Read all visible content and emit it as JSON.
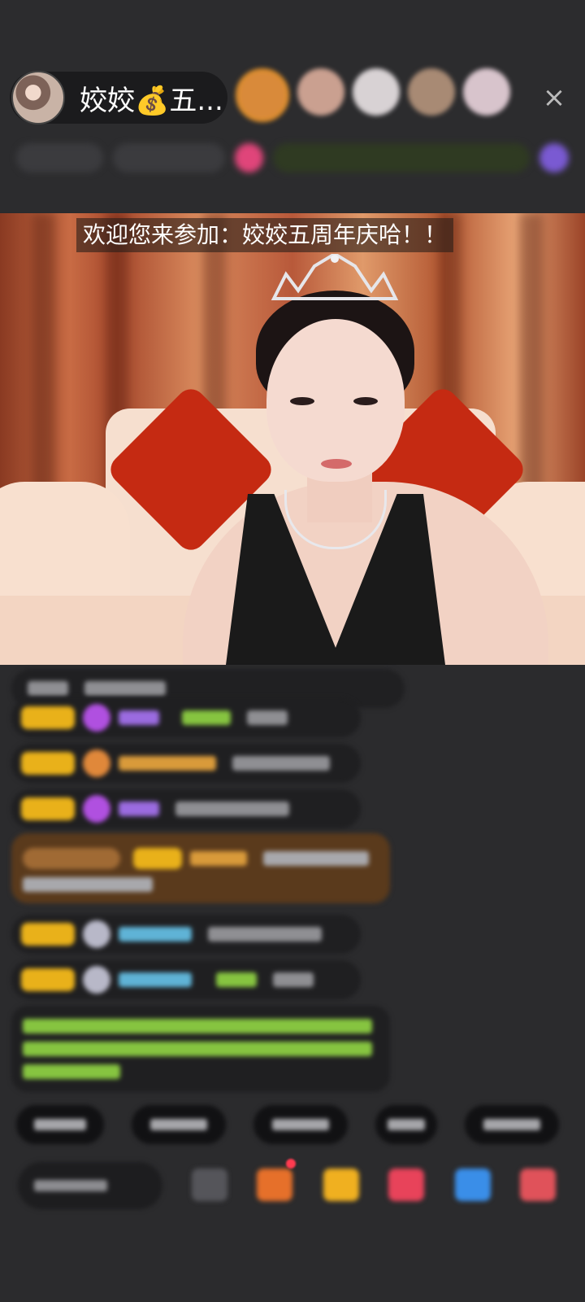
{
  "header": {
    "host_name": "姣姣💰五...",
    "close_icon": "×",
    "viewer_avatar_colors": [
      "#d98a3a",
      "#caa090",
      "#d8d2d4",
      "#a88a74",
      "#d8c4cc"
    ]
  },
  "stream": {
    "welcome_banner": "欢迎您来参加：姣姣五周年庆哈！！"
  },
  "colors": {
    "background": "#2b2b2d",
    "level_badge": "#e9b11a",
    "chat_name_purple": "#9b6be0",
    "chat_name_blue": "#5fb3d6",
    "chat_name_orange": "#d99a3a",
    "chat_notice_green": "#86c440"
  }
}
